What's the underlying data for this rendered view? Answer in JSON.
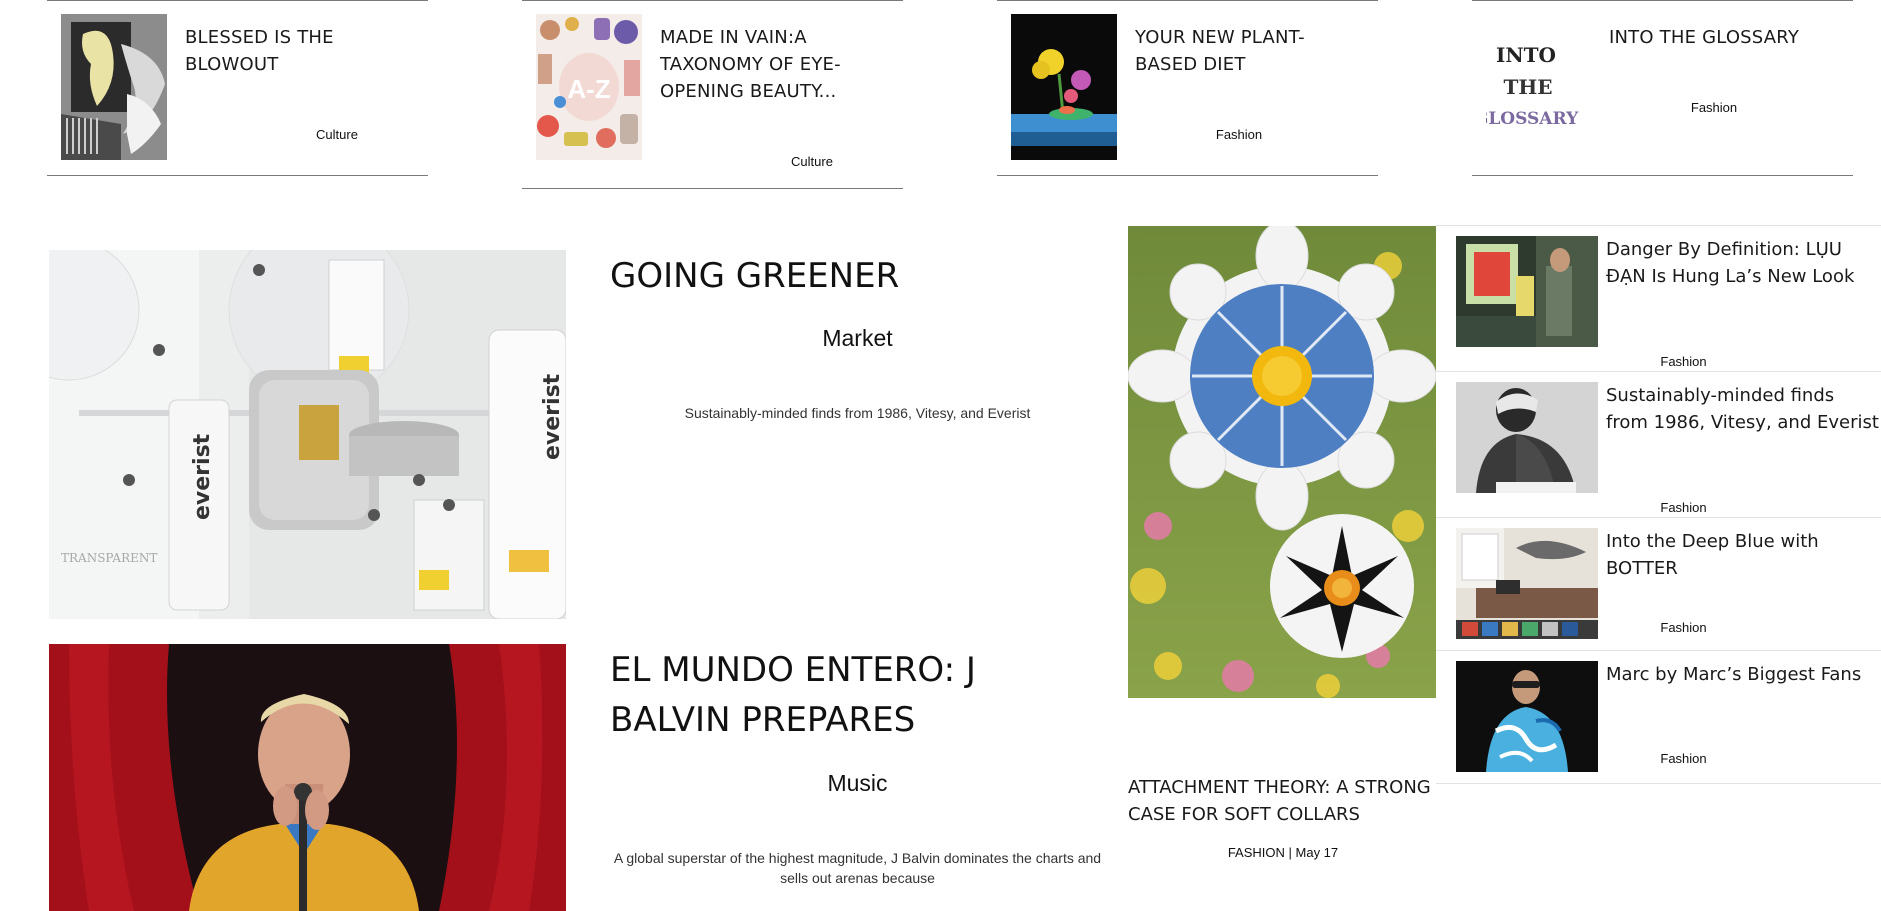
{
  "top_articles": [
    {
      "title": "BLESSED IS THE BLOWOUT",
      "category": "Culture",
      "thumb_icon": "hair-dryer-collage-image"
    },
    {
      "title": "MADE IN VAIN:A TAXONOMY OF EYE-OPENING BEAUTY...",
      "category": "Culture",
      "thumb_icon": "a-z-beauty-products-image"
    },
    {
      "title": "YOUR NEW PLANT-BASED DIET",
      "category": "Fashion",
      "thumb_icon": "flower-still-life-image"
    },
    {
      "title": "INTO THE GLOSSARY",
      "category": "Fashion",
      "thumb_icon": "into-the-glossary-logo-image",
      "thumb_text": "INTO THE GLOSSARY"
    }
  ],
  "features": [
    {
      "title": "GOING GREENER",
      "category": "Market",
      "description": "Sustainably-minded finds from 1986, Vitesy, and Everist",
      "image_icon": "everist-products-image",
      "image_text": [
        "everist",
        "everist",
        "TRANSPARENT"
      ]
    },
    {
      "title": "EL MUNDO ENTERO: J BALVIN PREPARES",
      "category": "Music",
      "description": "A global superstar of the highest magnitude, J Balvin dominates the charts and sells out arenas because",
      "image_icon": "j-balvin-stage-image"
    }
  ],
  "tall_article": {
    "title": "ATTACHMENT THEORY: A STRONG CASE FOR SOFT COLLARS",
    "category": "FASHION",
    "separator": " | ",
    "date": "May 17",
    "image_icon": "fabric-flowers-image"
  },
  "sidebar": [
    {
      "title": "Danger By Definition: LỤU ĐẠN Is Hung La’s New Look",
      "category": "Fashion",
      "thumb_icon": "street-market-image"
    },
    {
      "title": "Sustainably-minded finds from 1986, Vitesy, and Everist",
      "category": "Fashion",
      "thumb_icon": "model-back-portrait-image"
    },
    {
      "title": "Into the Deep Blue with BOTTER",
      "category": "Fashion",
      "thumb_icon": "design-studio-image"
    },
    {
      "title": "Marc by Marc’s Biggest Fans",
      "category": "Fashion",
      "thumb_icon": "blue-print-top-model-image"
    }
  ]
}
